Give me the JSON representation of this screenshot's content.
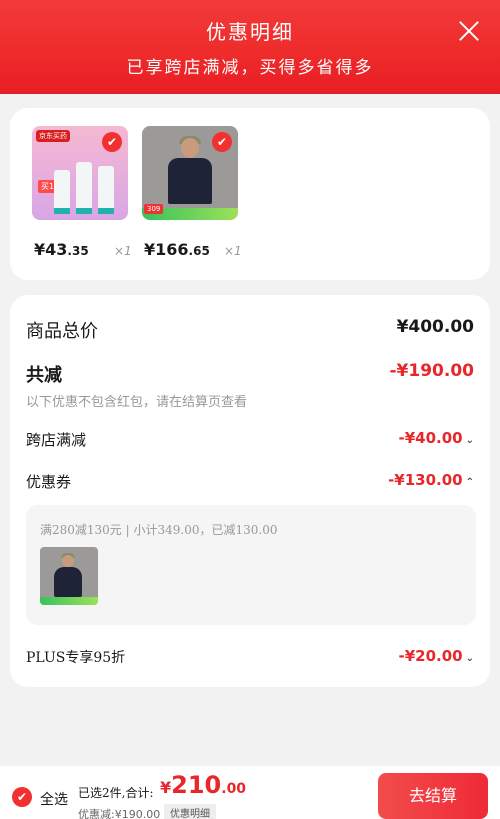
{
  "header": {
    "title": "优惠明细",
    "subtitle": "已享跨店满减，买得多省得多"
  },
  "products": [
    {
      "price_int": "¥43",
      "price_cents": ".35",
      "qty": "×1",
      "store_tag": "京东买药",
      "badge": "买1送1"
    },
    {
      "price_int": "¥166",
      "price_cents": ".65",
      "qty": "×1",
      "price_tag": "309"
    }
  ],
  "details": {
    "total_label": "商品总价",
    "total_value": "¥400.00",
    "reduce_label": "共减",
    "reduce_value": "-¥190.00",
    "note": "以下优惠不包含红包，请在结算页查看",
    "cross_store_label": "跨店满减",
    "cross_store_value": "-¥40.00",
    "coupon_label": "优惠券",
    "coupon_value": "-¥130.00",
    "coupon_desc": "满280减130元 | 小计349.00，已减130.00",
    "plus_label": "PLUS专享95折",
    "plus_value": "-¥20.00"
  },
  "footer": {
    "select_all": "全选",
    "summary": "已选2件,合计:",
    "total_yen": "¥",
    "total_int": "210",
    "total_cents": ".00",
    "saved": "优惠减:¥190.00",
    "detail_btn": "优惠明细",
    "checkout": "去结算"
  },
  "colors": {
    "accent": "#e9272b",
    "header_bg": "#ee2a2a"
  },
  "icons": [
    "close-icon",
    "check-icon",
    "chevron-down-icon",
    "chevron-up-icon"
  ]
}
